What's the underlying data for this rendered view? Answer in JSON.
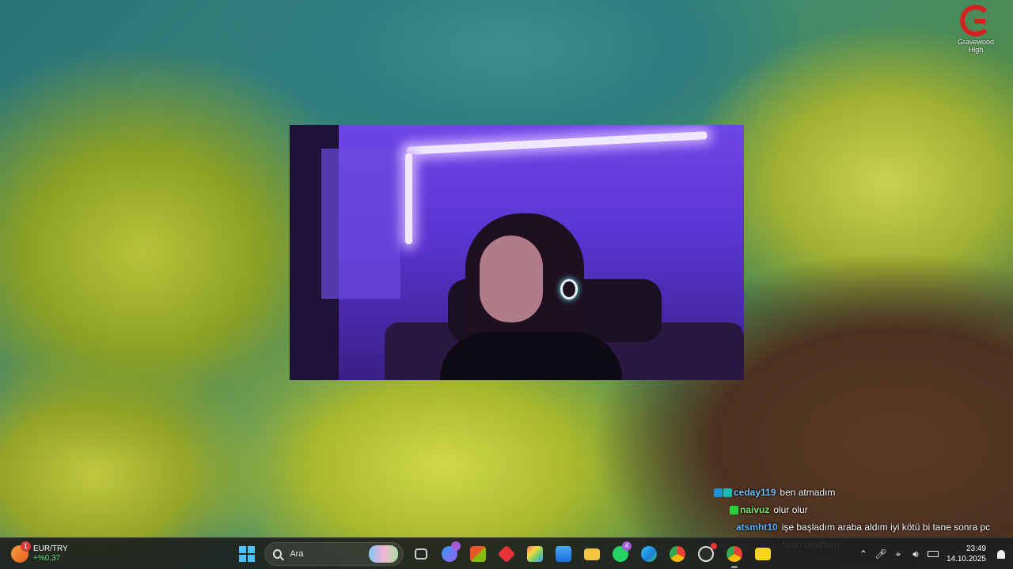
{
  "corner_logo": {
    "name": "Gravewood High",
    "icon": "red-g-logo-icon"
  },
  "webcam": {
    "icon": "webcam-feed"
  },
  "chat": {
    "messages": [
      {
        "user": "ceday119",
        "text": "ben atmadım",
        "user_color": "#6cc5ff"
      },
      {
        "user": "naivuz",
        "text": "olur olur",
        "user_color": "#7be36a"
      },
      {
        "user": "atsmht10",
        "text": "işe başladım araba aldım iyi kötü bi tane sonra pc falan unuttum",
        "user_color": "#4fb5ff"
      }
    ],
    "extra_user": "naivuz"
  },
  "taskbar": {
    "widget": {
      "badge": "1",
      "symbol": "EUR/TRY",
      "change": "+%0,37"
    },
    "search": {
      "placeholder": "Ara"
    },
    "apps": [
      {
        "icon": "task-view-icon"
      },
      {
        "icon": "copilot-icon",
        "badge": ""
      },
      {
        "icon": "microsoft-store-icon"
      },
      {
        "icon": "red-diamond-app-icon"
      },
      {
        "icon": "colorful-app-icon"
      },
      {
        "icon": "photos-icon"
      },
      {
        "icon": "file-explorer-icon"
      },
      {
        "icon": "whatsapp-icon",
        "badge": "4"
      },
      {
        "icon": "edge-icon"
      },
      {
        "icon": "chrome-icon"
      },
      {
        "icon": "obs-icon"
      },
      {
        "icon": "chrome-profile-icon"
      },
      {
        "icon": "sticky-notes-icon"
      }
    ],
    "clock": {
      "time": "23:49",
      "date": "14.10.2025"
    }
  }
}
